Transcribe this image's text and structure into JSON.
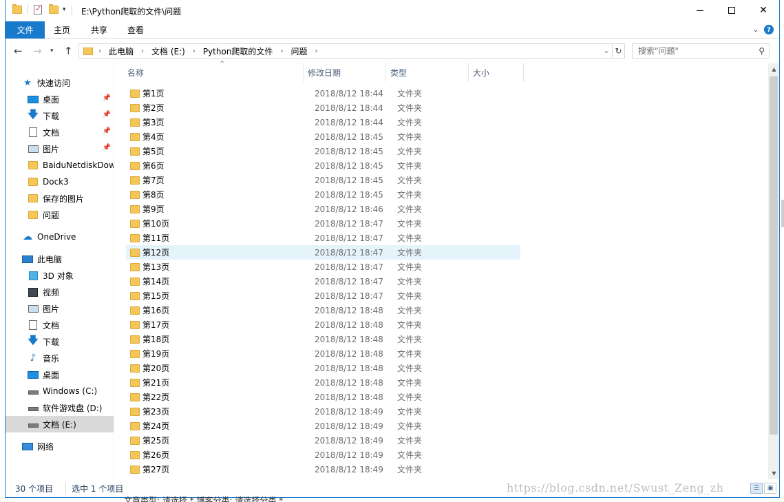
{
  "window": {
    "title": "E:\\Python爬取的文件\\问题",
    "min_label": "—",
    "close_label": "✕"
  },
  "ribbon": {
    "tabs": [
      "文件",
      "主页",
      "共享",
      "查看"
    ],
    "accent": "#1979ca",
    "help_label": "?"
  },
  "address": {
    "breadcrumbs": [
      "此电脑",
      "文档 (E:)",
      "Python爬取的文件",
      "问题"
    ],
    "search_placeholder": "搜索\"问题\""
  },
  "nav": {
    "items": [
      {
        "label": "快速访问",
        "icon": "star-icon",
        "pinned": false
      },
      {
        "label": "桌面",
        "icon": "desktop-icon",
        "pinned": true
      },
      {
        "label": "下载",
        "icon": "download-icon",
        "pinned": true
      },
      {
        "label": "文档",
        "icon": "document-icon",
        "pinned": true
      },
      {
        "label": "图片",
        "icon": "pictures-icon",
        "pinned": true
      },
      {
        "label": "BaiduNetdiskDow",
        "icon": "folder-icon",
        "pinned": false
      },
      {
        "label": "Dock3",
        "icon": "folder-icon",
        "pinned": false
      },
      {
        "label": "保存的图片",
        "icon": "folder-icon",
        "pinned": false
      },
      {
        "label": "问题",
        "icon": "folder-icon",
        "pinned": false
      },
      {
        "label": "OneDrive",
        "icon": "cloud-icon",
        "pinned": false
      },
      {
        "label": "此电脑",
        "icon": "computer-icon",
        "pinned": false
      },
      {
        "label": "3D 对象",
        "icon": "cube-icon",
        "pinned": false
      },
      {
        "label": "视频",
        "icon": "video-icon",
        "pinned": false
      },
      {
        "label": "图片",
        "icon": "pictures-icon",
        "pinned": false
      },
      {
        "label": "文档",
        "icon": "document-icon",
        "pinned": false
      },
      {
        "label": "下载",
        "icon": "download-icon",
        "pinned": false
      },
      {
        "label": "音乐",
        "icon": "music-icon",
        "pinned": false
      },
      {
        "label": "桌面",
        "icon": "desktop-icon",
        "pinned": false
      },
      {
        "label": "Windows (C:)",
        "icon": "drive-icon",
        "pinned": false
      },
      {
        "label": "软件游戏盘 (D:)",
        "icon": "drive-icon",
        "pinned": false
      },
      {
        "label": "文档 (E:)",
        "icon": "drive-icon",
        "pinned": false,
        "selected": true
      },
      {
        "label": "网络",
        "icon": "network-icon",
        "pinned": false
      }
    ]
  },
  "columns": {
    "name": "名称",
    "modified": "修改日期",
    "type": "类型",
    "size": "大小"
  },
  "files": [
    {
      "name": "第1页",
      "date": "2018/8/12 18:44",
      "type": "文件夹"
    },
    {
      "name": "第2页",
      "date": "2018/8/12 18:44",
      "type": "文件夹"
    },
    {
      "name": "第3页",
      "date": "2018/8/12 18:44",
      "type": "文件夹"
    },
    {
      "name": "第4页",
      "date": "2018/8/12 18:45",
      "type": "文件夹"
    },
    {
      "name": "第5页",
      "date": "2018/8/12 18:45",
      "type": "文件夹"
    },
    {
      "name": "第6页",
      "date": "2018/8/12 18:45",
      "type": "文件夹"
    },
    {
      "name": "第7页",
      "date": "2018/8/12 18:45",
      "type": "文件夹"
    },
    {
      "name": "第8页",
      "date": "2018/8/12 18:45",
      "type": "文件夹"
    },
    {
      "name": "第9页",
      "date": "2018/8/12 18:46",
      "type": "文件夹"
    },
    {
      "name": "第10页",
      "date": "2018/8/12 18:47",
      "type": "文件夹"
    },
    {
      "name": "第11页",
      "date": "2018/8/12 18:47",
      "type": "文件夹"
    },
    {
      "name": "第12页",
      "date": "2018/8/12 18:47",
      "type": "文件夹",
      "selected": true
    },
    {
      "name": "第13页",
      "date": "2018/8/12 18:47",
      "type": "文件夹"
    },
    {
      "name": "第14页",
      "date": "2018/8/12 18:47",
      "type": "文件夹"
    },
    {
      "name": "第15页",
      "date": "2018/8/12 18:47",
      "type": "文件夹"
    },
    {
      "name": "第16页",
      "date": "2018/8/12 18:48",
      "type": "文件夹"
    },
    {
      "name": "第17页",
      "date": "2018/8/12 18:48",
      "type": "文件夹"
    },
    {
      "name": "第18页",
      "date": "2018/8/12 18:48",
      "type": "文件夹"
    },
    {
      "name": "第19页",
      "date": "2018/8/12 18:48",
      "type": "文件夹"
    },
    {
      "name": "第20页",
      "date": "2018/8/12 18:48",
      "type": "文件夹"
    },
    {
      "name": "第21页",
      "date": "2018/8/12 18:48",
      "type": "文件夹"
    },
    {
      "name": "第22页",
      "date": "2018/8/12 18:48",
      "type": "文件夹"
    },
    {
      "name": "第23页",
      "date": "2018/8/12 18:49",
      "type": "文件夹"
    },
    {
      "name": "第24页",
      "date": "2018/8/12 18:49",
      "type": "文件夹"
    },
    {
      "name": "第25页",
      "date": "2018/8/12 18:49",
      "type": "文件夹"
    },
    {
      "name": "第26页",
      "date": "2018/8/12 18:49",
      "type": "文件夹"
    },
    {
      "name": "第27页",
      "date": "2018/8/12 18:49",
      "type": "文件夹"
    }
  ],
  "status": {
    "count": "30 个项目",
    "selected": "选中 1 个项目"
  },
  "watermark": "https://blog.csdn.net/Swust_Zeng_zh",
  "page_bleed": "文章类型:   请选择    *    博客分类:   请选择分类   *"
}
